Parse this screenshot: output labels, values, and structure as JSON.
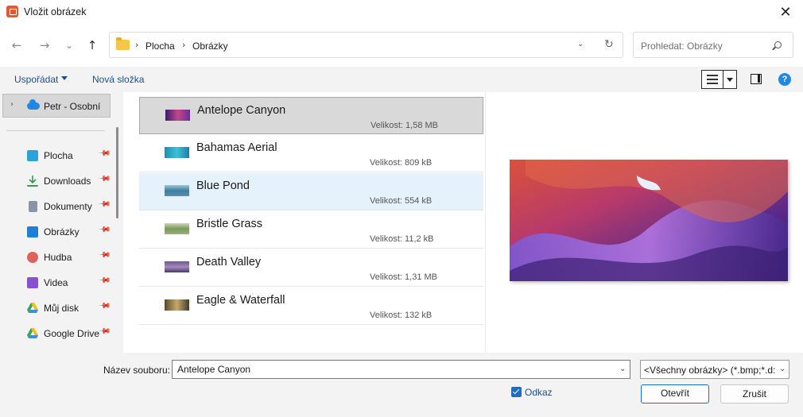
{
  "window": {
    "title": "Vložit obrázek",
    "close_glyph": "✕"
  },
  "nav": {
    "back_glyph": "←",
    "forward_glyph": "→",
    "recent_glyph": "⌄",
    "up_glyph": "↑",
    "breadcrumb": [
      "Plocha",
      "Obrázky"
    ],
    "search_placeholder": "Prohledat: Obrázky"
  },
  "toolbar": {
    "organize_label": "Uspořádat",
    "new_folder_label": "Nová složka",
    "help_label": "?"
  },
  "sidebar": {
    "onedrive_label": "Petr - Osobní",
    "items": [
      {
        "label": "Plocha",
        "icon": "desktop-icon",
        "color": "#29a3d9"
      },
      {
        "label": "Downloads",
        "icon": "download-icon",
        "color": "#2e9e5b"
      },
      {
        "label": "Dokumenty",
        "icon": "documents-icon",
        "color": "#8a94a6"
      },
      {
        "label": "Obrázky",
        "icon": "pictures-icon",
        "color": "#1e7fd6"
      },
      {
        "label": "Hudba",
        "icon": "music-icon",
        "color": "#e0625a"
      },
      {
        "label": "Videa",
        "icon": "videos-icon",
        "color": "#8a4fd1"
      },
      {
        "label": "Můj disk",
        "icon": "google-drive-icon",
        "color": "#34a853"
      },
      {
        "label": "Google Drive",
        "icon": "google-drive-icon",
        "color": "#fbbc05"
      }
    ]
  },
  "files": [
    {
      "name": "Antelope Canyon",
      "size": "Velikost: 1,58 MB"
    },
    {
      "name": "Bahamas Aerial",
      "size": "Velikost: 809 kB"
    },
    {
      "name": "Blue Pond",
      "size": "Velikost: 554 kB"
    },
    {
      "name": "Bristle Grass",
      "size": "Velikost: 11,2 kB"
    },
    {
      "name": "Death Valley",
      "size": "Velikost: 1,31 MB"
    },
    {
      "name": "Eagle & Waterfall",
      "size": "Velikost: 132 kB"
    }
  ],
  "footer": {
    "filename_label": "Název souboru:",
    "filename_value": "Antelope Canyon",
    "filter_value": "<Všechny obrázky> (*.bmp;*.d:",
    "link_label": "Odkaz",
    "link_checked": true,
    "open_label": "Otevřít",
    "cancel_label": "Zrušit"
  },
  "colors": {
    "accent": "#1a6fc4",
    "link": "#1a4f8f",
    "selection": "#d9d9d9",
    "hover": "#e5f1fb"
  }
}
